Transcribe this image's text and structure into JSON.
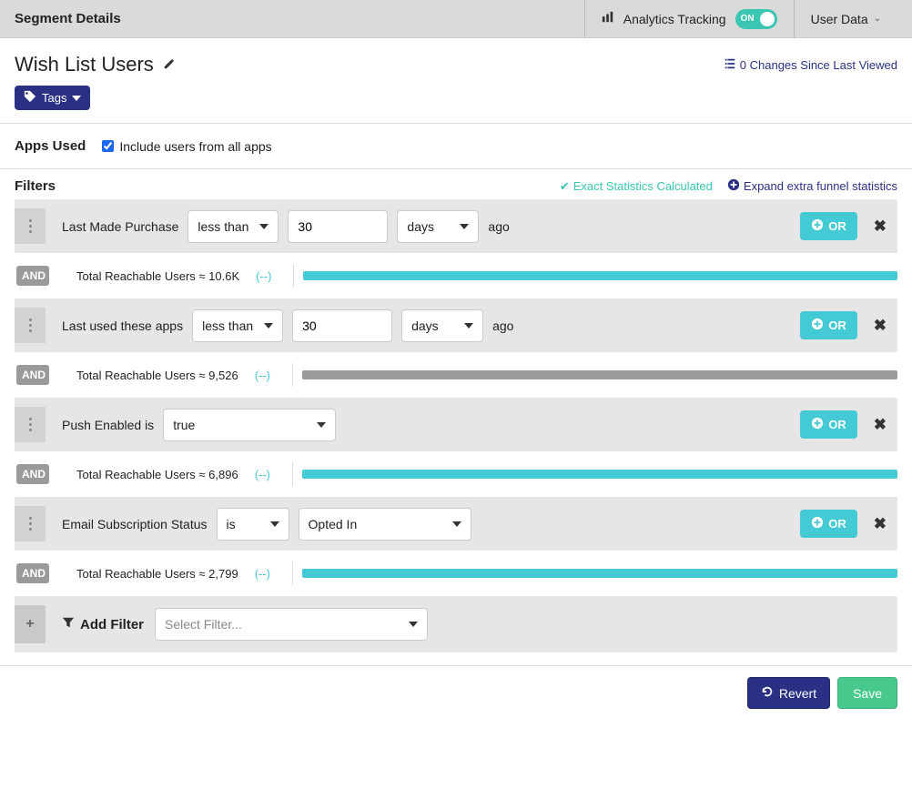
{
  "topbar": {
    "title": "Segment Details",
    "analytics_label": "Analytics Tracking",
    "toggle_state": "ON",
    "user_menu": "User Data"
  },
  "segment": {
    "name": "Wish List Users",
    "changes_label": "0 Changes Since Last Viewed",
    "tags_button": "Tags"
  },
  "apps": {
    "section_label": "Apps Used",
    "checkbox_label": "Include users from all apps"
  },
  "filters_head": {
    "label": "Filters",
    "stats_calc": "Exact Statistics Calculated",
    "expand": "Expand extra funnel statistics"
  },
  "filters": [
    {
      "label": "Last Made Purchase",
      "op": "less than",
      "value": "30",
      "unit": "days",
      "suffix": "ago",
      "reach_text": "Total Reachable Users ≈ 10.6K",
      "link": "(--)",
      "bar_color": "#44cad5",
      "bar_width": "100%"
    },
    {
      "label": "Last used these apps",
      "op": "less than",
      "value": "30",
      "unit": "days",
      "suffix": "ago",
      "reach_text": "Total Reachable Users ≈ 9,526",
      "link": "(--)",
      "bar_color": "#9a9a9a",
      "bar_width": "100%"
    },
    {
      "label": "Push Enabled is",
      "select_val": "true",
      "reach_text": "Total Reachable Users ≈ 6,896",
      "link": "(--)",
      "bar_color": "#44cad5",
      "bar_width": "100%"
    },
    {
      "label": "Email Subscription Status",
      "op": "is",
      "select_val": "Opted In",
      "reach_text": "Total Reachable Users ≈ 2,799",
      "link": "(--)",
      "bar_color": "#44cad5",
      "bar_width": "100%"
    }
  ],
  "common": {
    "and": "AND",
    "or": "OR"
  },
  "add_filter": {
    "label": "Add Filter",
    "placeholder": "Select Filter..."
  },
  "footer": {
    "revert": "Revert",
    "save": "Save"
  }
}
